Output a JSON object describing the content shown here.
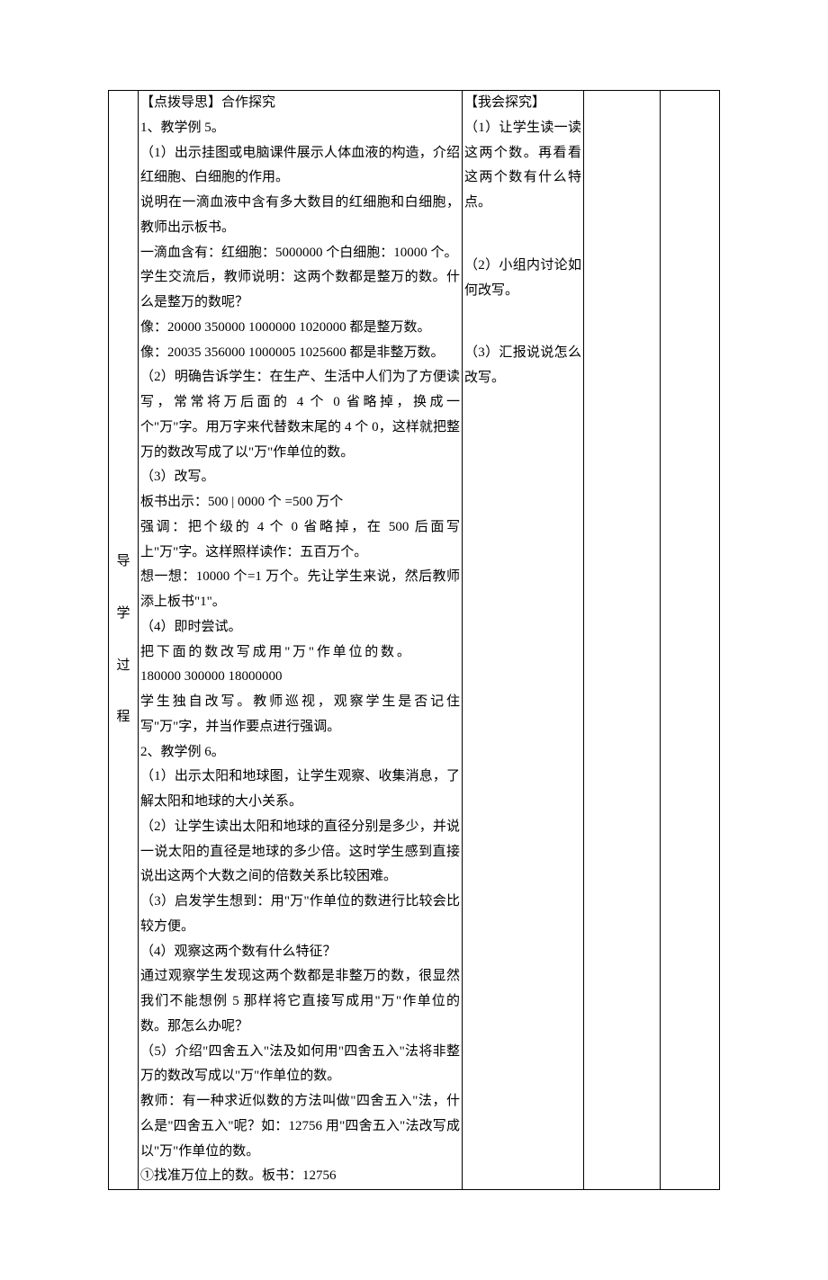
{
  "left_label": {
    "c1": "导",
    "c2": "学",
    "c3": "过",
    "c4": "程"
  },
  "main": {
    "h": "【点拨导思】合作探究",
    "t1": "1、教学例 5。",
    "p1": "（1）出示挂图或电脑课件展示人体血液的构造，介绍红细胞、白细胞的作用。",
    "p2": "说明在一滴血液中含有多大数目的红细胞和白细胞，教师出示板书。",
    "p3": "一滴血含有：红细胞：5000000 个白细胞：10000 个。",
    "p4": "学生交流后，教师说明：这两个数都是整万的数。什么是整万的数呢？",
    "p5": "像：20000 350000 1000000 1020000 都是整万数。",
    "p6": "像：20035 356000 1000005 1025600 都是非整万数。",
    "p7": "（2）明确告诉学生：在生产、生活中人们为了方便读写，常常将万后面的 4 个 0 省略掉，换成一个\"万\"字。用万字来代替数末尾的 4 个 0，这样就把整万的数改写成了以\"万\"作单位的数。",
    "p8": "（3）改写。",
    "p9": "板书出示：500 | 0000 个 =500 万个",
    "p10": "强调：把个级的 4 个 0 省略掉，在 500 后面写上\"万\"字。这样照样读作：五百万个。",
    "p11": "想一想：10000 个=1 万个。先让学生来说，然后教师添上板书\"1\"。",
    "p12": "（4）即时尝试。",
    "p13": "把下面的数改写成用\"万\"作单位的数。",
    "p14": "  180000    300000     18000000",
    "p15": "学生独自改写。教师巡视，观察学生是否记住写\"万\"字，并当作要点进行强调。",
    "t2": "2、教学例 6。",
    "q1": "（1）出示太阳和地球图，让学生观察、收集消息，了解太阳和地球的大小关系。",
    "q2": "（2）让学生读出太阳和地球的直径分别是多少，并说一说太阳的直径是地球的多少倍。这时学生感到直接说出这两个大数之间的倍数关系比较困难。",
    "q3": "（3）启发学生想到：用\"万\"作单位的数进行比较会比较方便。",
    "q4": "（4）观察这两个数有什么特征？",
    "q5": "通过观察学生发现这两个数都是非整万的数，很显然我们不能想例 5 那样将它直接写成用\"万\"作单位的数。那怎么办呢？",
    "q6": "（5）介绍\"四舍五入\"法及如何用\"四舍五入\"法将非整万的数改写成以\"万\"作单位的数。",
    "q7": "教师：有一种求近似数的方法叫做\"四舍五入\"法，什么是\"四舍五入\"呢？如：12756 用\"四舍五入\"法改写成以\"万\"作单位的数。",
    "q8": "①找准万位上的数。板书：12756"
  },
  "side": {
    "h": "【我会探究】",
    "s1": "（1）让学生读一读这两个数。再看看这两个数有什么特点。",
    "s2": "（2）小组内讨论如何改写。",
    "s3": "（3）汇报说说怎么改写。"
  }
}
